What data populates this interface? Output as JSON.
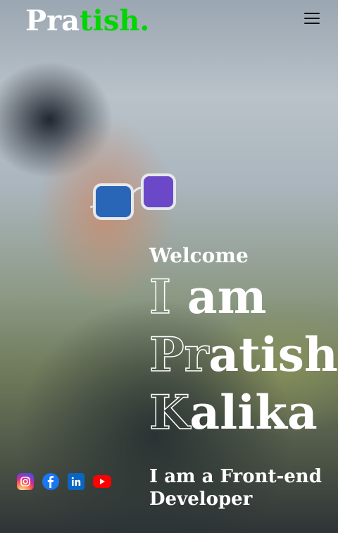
{
  "header": {
    "logo_main": "Pra",
    "logo_accent": "tish.",
    "menu_icon": "hamburger-menu-icon"
  },
  "hero": {
    "welcome": "Welcome",
    "line1_outline": "I",
    "line1_fill": " am",
    "line2_outline": "Pr",
    "line2_fill": "atish",
    "line3_outline": "K",
    "line3_fill": "alika",
    "role": "I am a Front-end Developer"
  },
  "socials": [
    {
      "name": "instagram",
      "icon": "instagram-icon"
    },
    {
      "name": "facebook",
      "icon": "facebook-icon"
    },
    {
      "name": "linkedin",
      "icon": "linkedin-icon"
    },
    {
      "name": "youtube",
      "icon": "youtube-icon"
    }
  ],
  "colors": {
    "accent": "#00d600",
    "text": "#ffffff",
    "menu": "#111111"
  }
}
